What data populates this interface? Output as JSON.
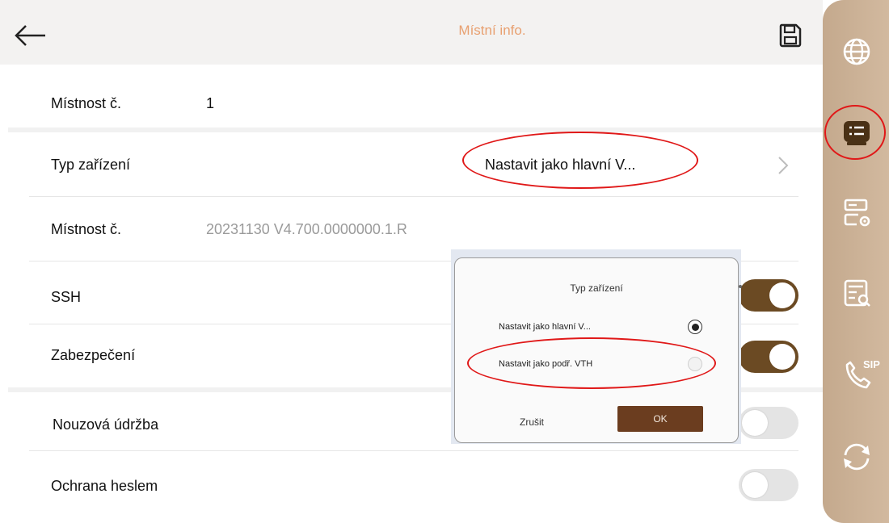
{
  "header": {
    "title": "Místní info."
  },
  "rows": {
    "room_number": {
      "label": "Místnost č.",
      "value": "1"
    },
    "device_type": {
      "label": "Typ zařízení",
      "value": "Nastavit jako hlavní V..."
    },
    "version": {
      "label": "Místnost č.",
      "value": "20231130 V4.700.0000000.1.R"
    },
    "ssh": {
      "label": "SSH",
      "enabled": true
    },
    "security": {
      "label": "Zabezpečení",
      "enabled": true
    },
    "emergency_maintenance": {
      "label": "Nouzová údržba",
      "enabled": false
    },
    "password_protection": {
      "label": "Ochrana heslem",
      "enabled": false
    }
  },
  "dialog": {
    "title": "Typ zařízení",
    "options": [
      {
        "label": "Nastavit jako hlavní V...",
        "selected": true
      },
      {
        "label": "Nastavit jako podř. VTH",
        "selected": false
      }
    ],
    "cancel_label": "Zrušit",
    "ok_label": "OK"
  },
  "sidebar": {
    "items": [
      {
        "icon": "globe-icon"
      },
      {
        "icon": "device-info-icon",
        "active": true
      },
      {
        "icon": "server-settings-icon"
      },
      {
        "icon": "server-search-icon"
      },
      {
        "icon": "sip-phone-icon",
        "badge": "SIP"
      },
      {
        "icon": "sync-icon"
      }
    ]
  },
  "colors": {
    "accent_brown": "#6b4a23",
    "title_orange": "#e8a070",
    "sidebar_tan": "#c9ae93",
    "annotation_red": "#e01818"
  }
}
